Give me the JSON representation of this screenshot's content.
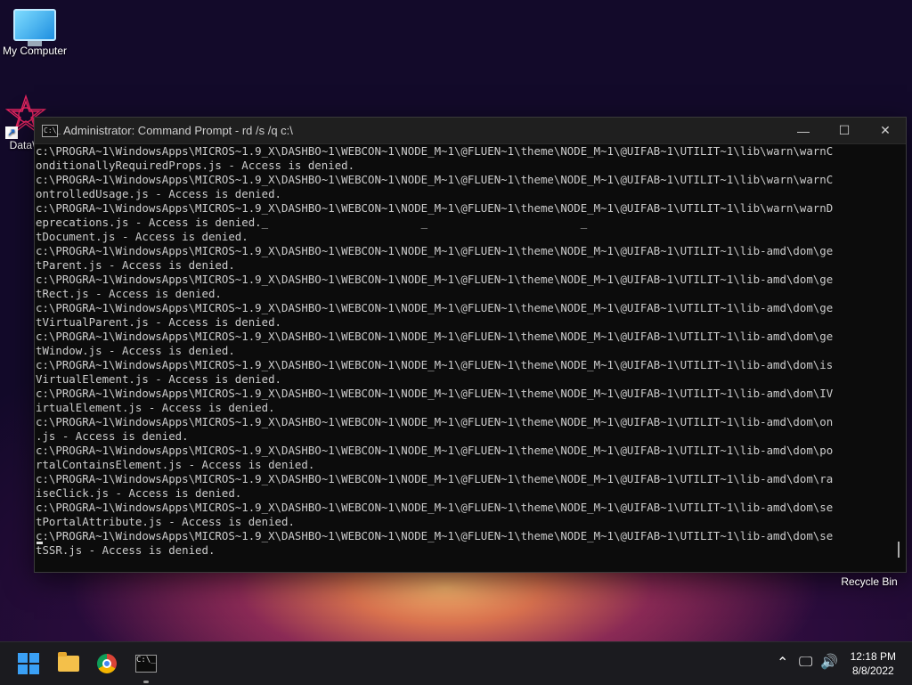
{
  "desktop": {
    "icons": [
      {
        "label": "My Computer"
      },
      {
        "label": "DataW"
      }
    ],
    "recycle_bin_label": "Recycle Bin"
  },
  "window": {
    "title": "Administrator: Command Prompt - rd  /s /q c:\\",
    "minimize_symbol": "—",
    "maximize_symbol": "☐",
    "close_symbol": "✕"
  },
  "console_lines": [
    "c:\\PROGRA~1\\WindowsApps\\MICROS~1.9_X\\DASHBO~1\\WEBCON~1\\NODE_M~1\\@FLUEN~1\\theme\\NODE_M~1\\@UIFAB~1\\UTILIT~1\\lib\\warn\\warnC",
    "onditionallyRequiredProps.js - Access is denied.",
    "c:\\PROGRA~1\\WindowsApps\\MICROS~1.9_X\\DASHBO~1\\WEBCON~1\\NODE_M~1\\@FLUEN~1\\theme\\NODE_M~1\\@UIFAB~1\\UTILIT~1\\lib\\warn\\warnC",
    "ontrolledUsage.js - Access is denied.",
    "c:\\PROGRA~1\\WindowsApps\\MICROS~1.9_X\\DASHBO~1\\WEBCON~1\\NODE_M~1\\@FLUEN~1\\theme\\NODE_M~1\\@UIFAB~1\\UTILIT~1\\lib\\warn\\warnD",
    "eprecations.js - Access is denied._                       _                       _",
    "tDocument.js - Access is denied.",
    "c:\\PROGRA~1\\WindowsApps\\MICROS~1.9_X\\DASHBO~1\\WEBCON~1\\NODE_M~1\\@FLUEN~1\\theme\\NODE_M~1\\@UIFAB~1\\UTILIT~1\\lib-amd\\dom\\ge",
    "tParent.js - Access is denied.",
    "c:\\PROGRA~1\\WindowsApps\\MICROS~1.9_X\\DASHBO~1\\WEBCON~1\\NODE_M~1\\@FLUEN~1\\theme\\NODE_M~1\\@UIFAB~1\\UTILIT~1\\lib-amd\\dom\\ge",
    "tRect.js - Access is denied.",
    "c:\\PROGRA~1\\WindowsApps\\MICROS~1.9_X\\DASHBO~1\\WEBCON~1\\NODE_M~1\\@FLUEN~1\\theme\\NODE_M~1\\@UIFAB~1\\UTILIT~1\\lib-amd\\dom\\ge",
    "tVirtualParent.js - Access is denied.",
    "c:\\PROGRA~1\\WindowsApps\\MICROS~1.9_X\\DASHBO~1\\WEBCON~1\\NODE_M~1\\@FLUEN~1\\theme\\NODE_M~1\\@UIFAB~1\\UTILIT~1\\lib-amd\\dom\\ge",
    "tWindow.js - Access is denied.",
    "c:\\PROGRA~1\\WindowsApps\\MICROS~1.9_X\\DASHBO~1\\WEBCON~1\\NODE_M~1\\@FLUEN~1\\theme\\NODE_M~1\\@UIFAB~1\\UTILIT~1\\lib-amd\\dom\\is",
    "VirtualElement.js - Access is denied.",
    "c:\\PROGRA~1\\WindowsApps\\MICROS~1.9_X\\DASHBO~1\\WEBCON~1\\NODE_M~1\\@FLUEN~1\\theme\\NODE_M~1\\@UIFAB~1\\UTILIT~1\\lib-amd\\dom\\IV",
    "irtualElement.js - Access is denied.",
    "c:\\PROGRA~1\\WindowsApps\\MICROS~1.9_X\\DASHBO~1\\WEBCON~1\\NODE_M~1\\@FLUEN~1\\theme\\NODE_M~1\\@UIFAB~1\\UTILIT~1\\lib-amd\\dom\\on",
    ".js - Access is denied.",
    "c:\\PROGRA~1\\WindowsApps\\MICROS~1.9_X\\DASHBO~1\\WEBCON~1\\NODE_M~1\\@FLUEN~1\\theme\\NODE_M~1\\@UIFAB~1\\UTILIT~1\\lib-amd\\dom\\po",
    "rtalContainsElement.js - Access is denied.",
    "c:\\PROGRA~1\\WindowsApps\\MICROS~1.9_X\\DASHBO~1\\WEBCON~1\\NODE_M~1\\@FLUEN~1\\theme\\NODE_M~1\\@UIFAB~1\\UTILIT~1\\lib-amd\\dom\\ra",
    "iseClick.js - Access is denied.",
    "c:\\PROGRA~1\\WindowsApps\\MICROS~1.9_X\\DASHBO~1\\WEBCON~1\\NODE_M~1\\@FLUEN~1\\theme\\NODE_M~1\\@UIFAB~1\\UTILIT~1\\lib-amd\\dom\\se",
    "tPortalAttribute.js - Access is denied.",
    "c:\\PROGRA~1\\WindowsApps\\MICROS~1.9_X\\DASHBO~1\\WEBCON~1\\NODE_M~1\\@FLUEN~1\\theme\\NODE_M~1\\@UIFAB~1\\UTILIT~1\\lib-amd\\dom\\se",
    "tSSR.js - Access is denied."
  ],
  "taskbar": {
    "apps": [
      {
        "name": "start",
        "icon": "windows-logo-icon"
      },
      {
        "name": "file-explorer",
        "icon": "folder-icon"
      },
      {
        "name": "chrome",
        "icon": "chrome-icon"
      },
      {
        "name": "command-prompt",
        "icon": "cmd-icon",
        "cmd_glyph": "C:\\_"
      }
    ],
    "tray": {
      "chevron": "⌃",
      "network": "🖵",
      "volume": "🔊"
    },
    "time": "12:18 PM",
    "date": "8/8/2022"
  },
  "colors": {
    "console_bg": "#0c0c0c",
    "console_text": "#cccccc",
    "titlebar": "#1f1f1f",
    "taskbar": "#1b1b1f",
    "windows_blue": "#3aa0f5"
  }
}
